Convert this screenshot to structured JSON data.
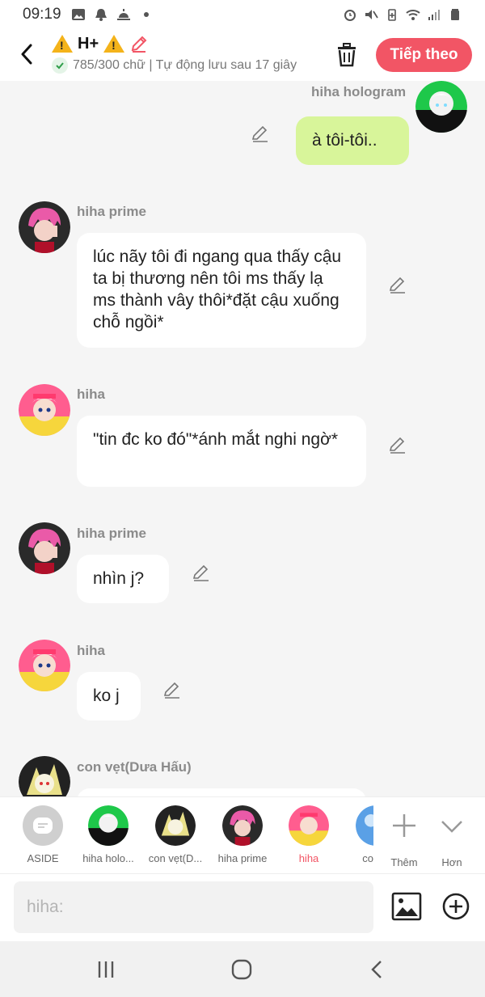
{
  "status_bar": {
    "time": "09:19",
    "left_icons": [
      "image-icon",
      "bell-icon",
      "sunrise-icon",
      "dot-icon"
    ],
    "right_icons": [
      "alarm-icon",
      "mute-icon",
      "battery-saver-icon",
      "wifi-icon",
      "signal-icon",
      "battery-icon"
    ]
  },
  "header": {
    "title": "H+",
    "status": "785/300 chữ | Tự động lưu sau 17 giây",
    "next_label": "Tiếp theo",
    "accent_color": "#f25565"
  },
  "messages": [
    {
      "sender": "hiha hologram",
      "text": "à tôi-tôi..",
      "mine": true,
      "avatar": "hiha-hologram-avatar"
    },
    {
      "sender": "hiha prime",
      "text": "lúc nãy tôi đi ngang qua thấy cậu ta bị thương nên tôi ms thấy lạ ms thành vây thôi*đặt cậu xuống chỗ ngồi*",
      "mine": false,
      "avatar": "hiha-prime-avatar"
    },
    {
      "sender": "hiha",
      "text": "\"tin đc ko đó\"*ánh mắt nghi ngờ*",
      "mine": false,
      "avatar": "hiha-avatar"
    },
    {
      "sender": "hiha prime",
      "text": "nhìn j?",
      "mine": false,
      "avatar": "hiha-prime-avatar"
    },
    {
      "sender": "hiha",
      "text": "ko j",
      "mine": false,
      "avatar": "hiha-avatar"
    },
    {
      "sender": "con vẹt(Dưa Hấu)",
      "text": "",
      "mine": false,
      "avatar": "con-vet-avatar"
    }
  ],
  "characters": [
    {
      "label": "ASIDE",
      "active": false
    },
    {
      "label": "hiha holo...",
      "active": false
    },
    {
      "label": "con vẹt(D...",
      "active": false
    },
    {
      "label": "hiha prime",
      "active": false
    },
    {
      "label": "hiha",
      "active": true
    },
    {
      "label": "co",
      "active": false
    }
  ],
  "tools": {
    "add_label": "Thêm",
    "more_label": "Hơn"
  },
  "input": {
    "placeholder": "hiha:"
  },
  "nav": [
    "recent-apps-icon",
    "home-icon",
    "back-icon"
  ]
}
